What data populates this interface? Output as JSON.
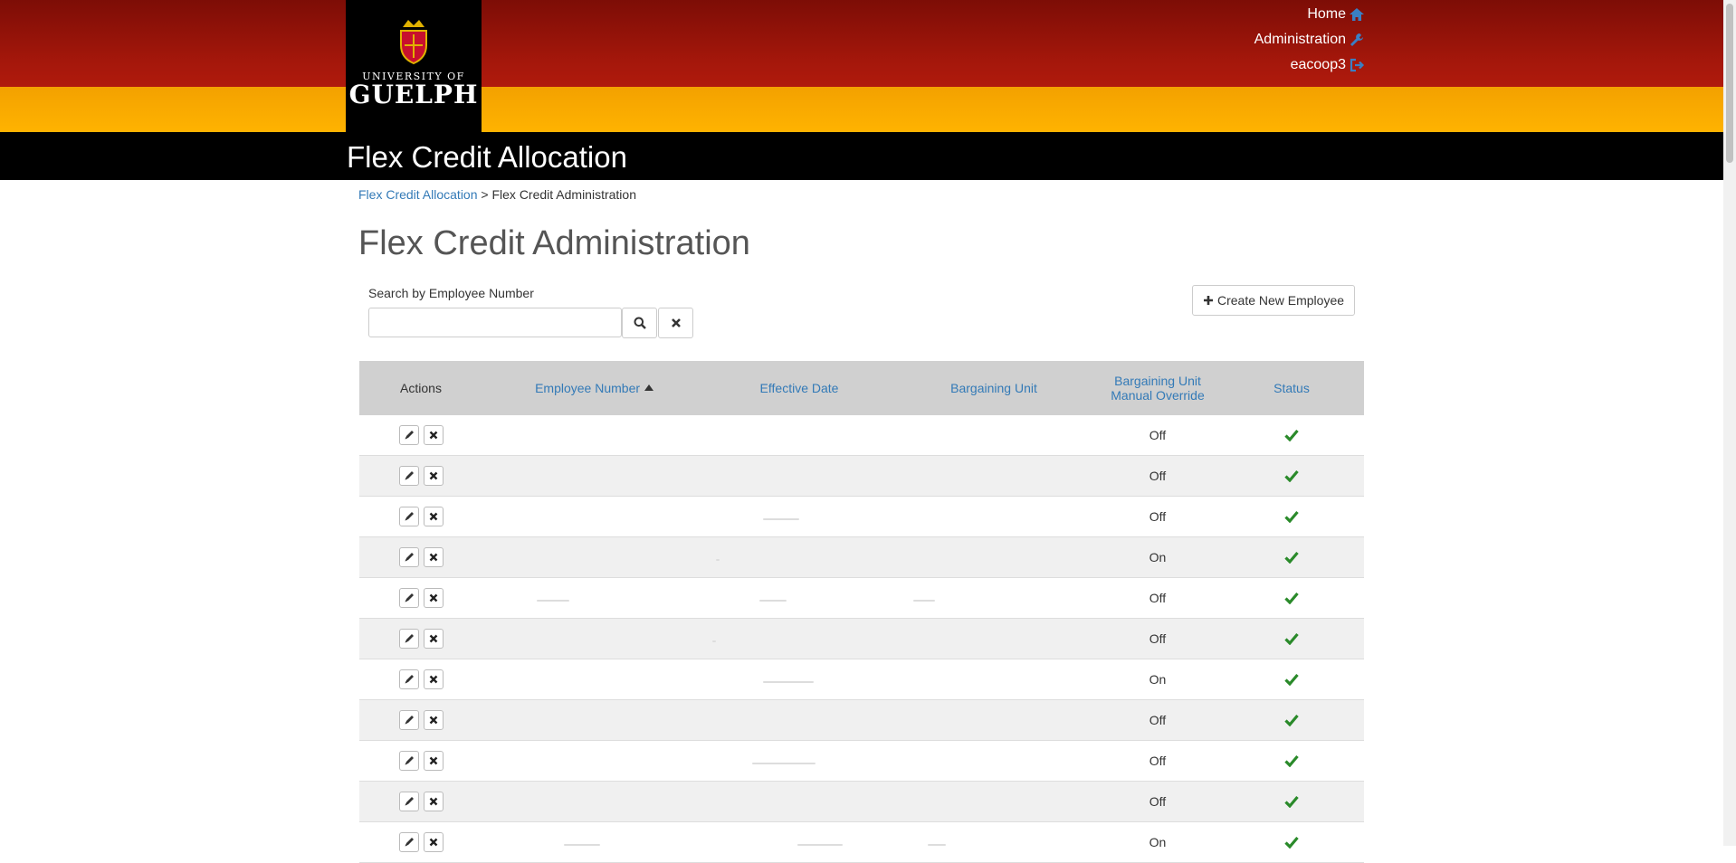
{
  "header": {
    "logo_line1": "UNIVERSITY OF",
    "logo_line2": "GUELPH",
    "app_title": "Flex Credit Allocation",
    "nav": [
      {
        "label": "Home",
        "icon": "home-icon"
      },
      {
        "label": "Administration",
        "icon": "wrench-icon"
      },
      {
        "label": "eacoop3",
        "icon": "sign-out-icon"
      }
    ]
  },
  "breadcrumb": {
    "link": "Flex Credit Allocation",
    "separator": ">",
    "current": "Flex Credit Administration"
  },
  "page_title": "Flex Credit Administration",
  "search": {
    "label": "Search by Employee Number",
    "value": "",
    "search_icon": "search-icon",
    "clear_icon": "close-icon"
  },
  "create_button": {
    "label": "Create New Employee",
    "icon": "plus-icon"
  },
  "table": {
    "columns": [
      {
        "label": "Actions"
      },
      {
        "label": "Employee Number",
        "sort": "ascending"
      },
      {
        "label": "Effective Date"
      },
      {
        "label": "Bargaining Unit"
      },
      {
        "label": "Bargaining Unit Manual Override"
      },
      {
        "label": "Status"
      }
    ],
    "rows": [
      {
        "override": "Off",
        "status": "check-icon"
      },
      {
        "override": "Off",
        "status": "check-icon"
      },
      {
        "override": "Off",
        "status": "check-icon"
      },
      {
        "override": "On",
        "status": "check-icon"
      },
      {
        "override": "Off",
        "status": "check-icon"
      },
      {
        "override": "Off",
        "status": "check-icon"
      },
      {
        "override": "On",
        "status": "check-icon"
      },
      {
        "override": "Off",
        "status": "check-icon"
      },
      {
        "override": "Off",
        "status": "check-icon"
      },
      {
        "override": "Off",
        "status": "check-icon"
      },
      {
        "override": "On",
        "status": "check-icon"
      }
    ]
  },
  "colors": {
    "header_red": "#a4170b",
    "header_gold": "#ffb300",
    "link_blue": "#337ab7",
    "status_green": "#2a8a2a"
  }
}
